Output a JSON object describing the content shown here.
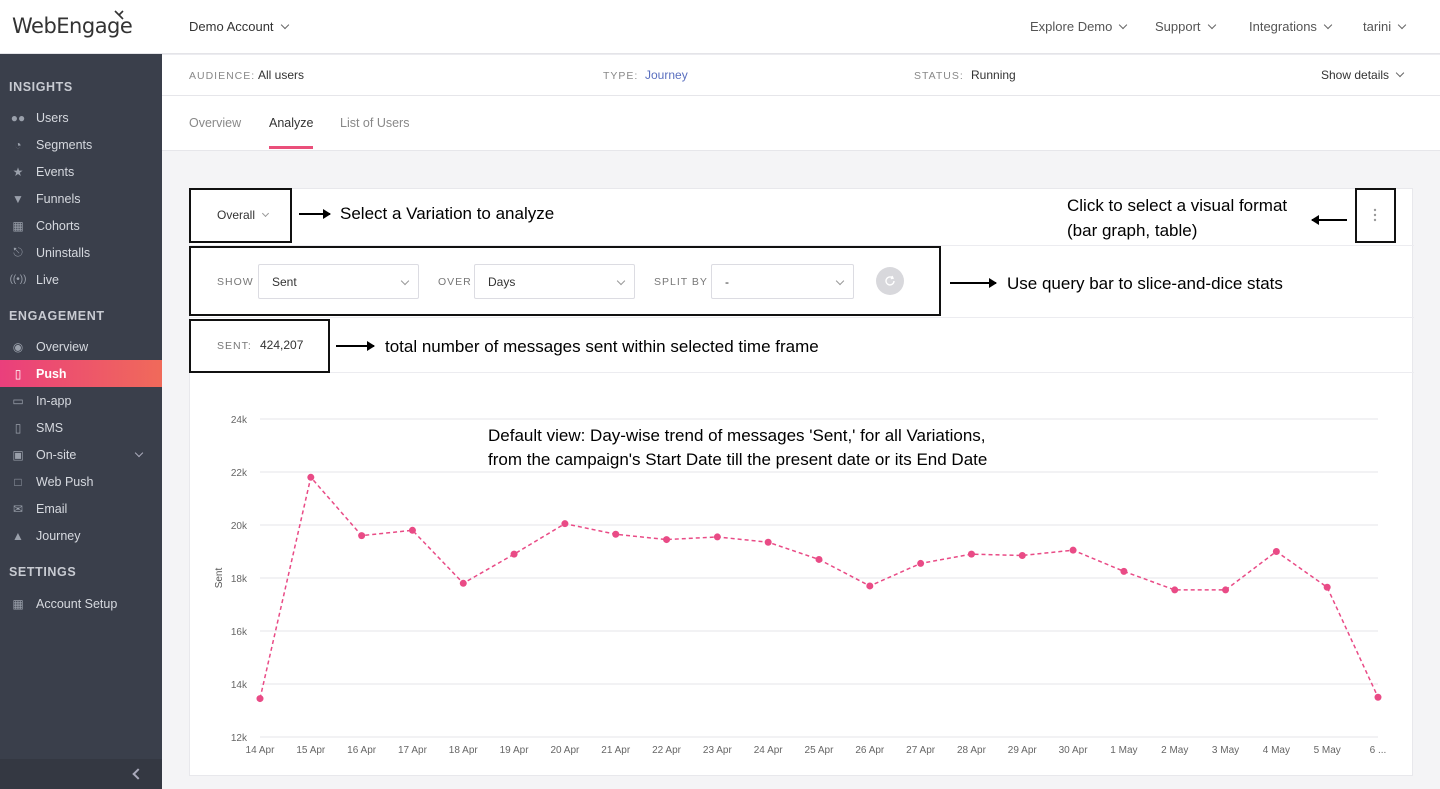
{
  "app": {
    "logo_text": "WebEngage"
  },
  "topbar": {
    "account": "Demo Account",
    "nav": [
      {
        "label": "Explore Demo"
      },
      {
        "label": "Support"
      },
      {
        "label": "Integrations"
      },
      {
        "label": "tarini"
      }
    ]
  },
  "sidebar": {
    "sections": [
      {
        "title": "INSIGHTS"
      },
      {
        "title": "ENGAGEMENT"
      },
      {
        "title": "SETTINGS"
      }
    ],
    "items": [
      {
        "label": "Users",
        "icon": "users-icon"
      },
      {
        "label": "Segments",
        "icon": "pie-icon"
      },
      {
        "label": "Events",
        "icon": "star-icon"
      },
      {
        "label": "Funnels",
        "icon": "funnel-icon"
      },
      {
        "label": "Cohorts",
        "icon": "grid-icon"
      },
      {
        "label": "Uninstalls",
        "icon": "uninstall-icon"
      },
      {
        "label": "Live",
        "icon": "broadcast-icon"
      },
      {
        "label": "Overview",
        "icon": "eye-icon"
      },
      {
        "label": "Push",
        "icon": "mobile-icon"
      },
      {
        "label": "In-app",
        "icon": "inapp-icon"
      },
      {
        "label": "SMS",
        "icon": "sms-icon"
      },
      {
        "label": "On-site",
        "icon": "onsite-icon"
      },
      {
        "label": "Web Push",
        "icon": "webpush-icon"
      },
      {
        "label": "Email",
        "icon": "email-icon"
      },
      {
        "label": "Journey",
        "icon": "journey-icon"
      },
      {
        "label": "Account Setup",
        "icon": "setup-icon"
      }
    ]
  },
  "info": {
    "audience_label": "AUDIENCE:",
    "audience_value": "All users",
    "type_label": "TYPE:",
    "type_value": "Journey",
    "status_label": "STATUS:",
    "status_value": "Running",
    "show_details": "Show details"
  },
  "tabs": [
    {
      "label": "Overview"
    },
    {
      "label": "Analyze"
    },
    {
      "label": "List of Users"
    }
  ],
  "analyze": {
    "variation": "Overall",
    "query": {
      "show_label": "SHOW",
      "show_value": "Sent",
      "over_label": "OVER",
      "over_value": "Days",
      "split_label": "SPLIT BY",
      "split_value": "-"
    },
    "stat_label": "SENT:",
    "stat_value": "424,207"
  },
  "annotations": {
    "variation": "Select a Variation to analyze",
    "format_line1": "Click to select a visual format",
    "format_line2": "(bar graph, table)",
    "query": "Use query bar to slice-and-dice stats",
    "total": "total number of messages sent within selected time frame",
    "default_line1": "Default view: Day-wise trend of messages 'Sent,' for all Variations,",
    "default_line2": "from the campaign's Start Date till the present date or its End Date"
  },
  "colors": {
    "accent": "#ea4f7a",
    "sidebar": "#3a3f4b",
    "link": "#5a6fbf"
  },
  "chart_data": {
    "type": "line",
    "ylabel": "Sent",
    "xlabel": "",
    "ylim": [
      12000,
      24000
    ],
    "yticks": [
      "12k",
      "14k",
      "16k",
      "18k",
      "20k",
      "22k",
      "24k"
    ],
    "categories": [
      "14 Apr",
      "15 Apr",
      "16 Apr",
      "17 Apr",
      "18 Apr",
      "19 Apr",
      "20 Apr",
      "21 Apr",
      "22 Apr",
      "23 Apr",
      "24 Apr",
      "25 Apr",
      "26 Apr",
      "27 Apr",
      "28 Apr",
      "29 Apr",
      "30 Apr",
      "1 May",
      "2 May",
      "3 May",
      "4 May",
      "5 May",
      "6 ..."
    ],
    "series": [
      {
        "color": "#e94b86",
        "style": "dashed",
        "values": [
          13450,
          21800,
          19600,
          19800,
          17800,
          18900,
          20050,
          19650,
          19450,
          19550,
          19350,
          18700,
          17700,
          18550,
          18900,
          18850,
          19050,
          18250,
          17550,
          17550,
          19000,
          17650,
          13500
        ]
      }
    ],
    "grid": true
  }
}
